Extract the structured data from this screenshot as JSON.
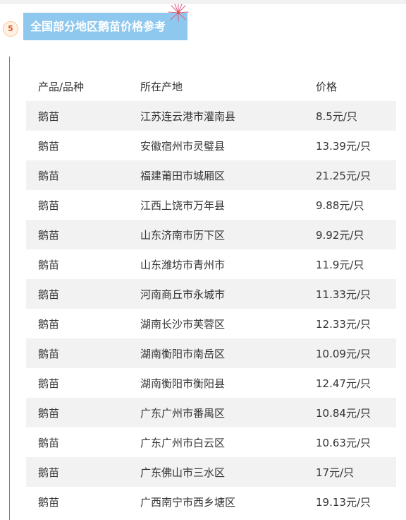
{
  "section": {
    "number": "5",
    "title": "全国部分地区鹅苗价格参考"
  },
  "table": {
    "headers": [
      "产品/品种",
      "所在产地",
      "价格"
    ],
    "rows": [
      [
        "鹅苗",
        "江苏连云港市灌南县",
        "8.5元/只"
      ],
      [
        "鹅苗",
        "安徽宿州市灵璧县",
        "13.39元/只"
      ],
      [
        "鹅苗",
        "福建莆田市城厢区",
        "21.25元/只"
      ],
      [
        "鹅苗",
        "江西上饶市万年县",
        "9.88元/只"
      ],
      [
        "鹅苗",
        "山东济南市历下区",
        "9.92元/只"
      ],
      [
        "鹅苗",
        "山东潍坊市青州市",
        "11.9元/只"
      ],
      [
        "鹅苗",
        "河南商丘市永城市",
        "11.33元/只"
      ],
      [
        "鹅苗",
        "湖南长沙市芙蓉区",
        "12.33元/只"
      ],
      [
        "鹅苗",
        "湖南衡阳市南岳区",
        "10.09元/只"
      ],
      [
        "鹅苗",
        "湖南衡阳市衡阳县",
        "12.47元/只"
      ],
      [
        "鹅苗",
        "广东广州市番禺区",
        "10.84元/只"
      ],
      [
        "鹅苗",
        "广东广州市白云区",
        "10.63元/只"
      ],
      [
        "鹅苗",
        "广东佛山市三水区",
        "17元/只"
      ],
      [
        "鹅苗",
        "广西南宁市西乡塘区",
        "19.13元/只"
      ]
    ]
  },
  "colors": {
    "title_bg": "#8ec8ef",
    "accent": "#e05a2f",
    "row_alt": "#f2f2f2"
  }
}
